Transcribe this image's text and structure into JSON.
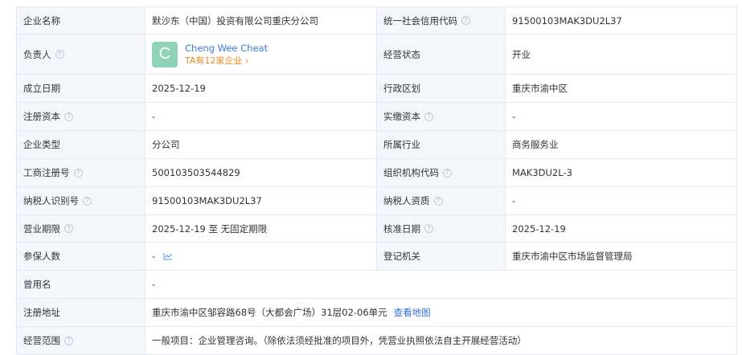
{
  "rows": [
    {
      "l1": "企业名称",
      "v1": "默沙东（中国）投资有限公司重庆分公司",
      "l2": "统一社会信用代码",
      "v2": "91500103MAK3DU2L37"
    },
    {
      "l1": "负责人",
      "l2": "经营状态",
      "v2": "开业"
    },
    {
      "l1": "成立日期",
      "v1": "2025-12-19",
      "l2": "行政区划",
      "v2": "重庆市渝中区"
    },
    {
      "l1": "注册资本",
      "v1": "-",
      "l2": "实缴资本",
      "v2": "-"
    },
    {
      "l1": "企业类型",
      "v1": "分公司",
      "l2": "所属行业",
      "v2": "商务服务业"
    },
    {
      "l1": "工商注册号",
      "v1": "500103503544829",
      "l2": "组织机构代码",
      "v2": "MAK3DU2L-3"
    },
    {
      "l1": "纳税人识别号",
      "v1": "91500103MAK3DU2L37",
      "l2": "纳税人资质",
      "v2": "-"
    },
    {
      "l1": "营业期限",
      "v1": "2025-12-19 至 无固定期限",
      "l2": "核准日期",
      "v2": "2025-12-19"
    },
    {
      "l1": "参保人数",
      "v1": "-",
      "l2": "登记机关",
      "v2": "重庆市渝中区市场监督管理局"
    },
    {
      "l1": "曾用名",
      "v1": "-"
    },
    {
      "l1": "注册地址",
      "v1": "重庆市渝中区邹容路68号（大都会广场）31层02-06单元",
      "link": "查看地图"
    },
    {
      "l1": "经营范围",
      "v1": "一般项目：企业管理咨询。（除依法须经批准的项目外，凭营业执照依法自主开展经营活动）"
    }
  ],
  "person": {
    "avatar_letter": "C",
    "name": "Cheng Wee Cheat",
    "more": "TA有12家企业",
    "chevron": "›"
  },
  "help_glyph": "?",
  "colors": {
    "label_bg": "#f3f7fd",
    "border": "#e6eaf0",
    "link": "#2f70d6",
    "person_name": "#3a79d8",
    "person_more": "#ef8b1f",
    "avatar_bg": "#8fd3b8"
  },
  "icons": [
    "help-icon",
    "trend-chart-icon",
    "chevron-right-icon"
  ]
}
